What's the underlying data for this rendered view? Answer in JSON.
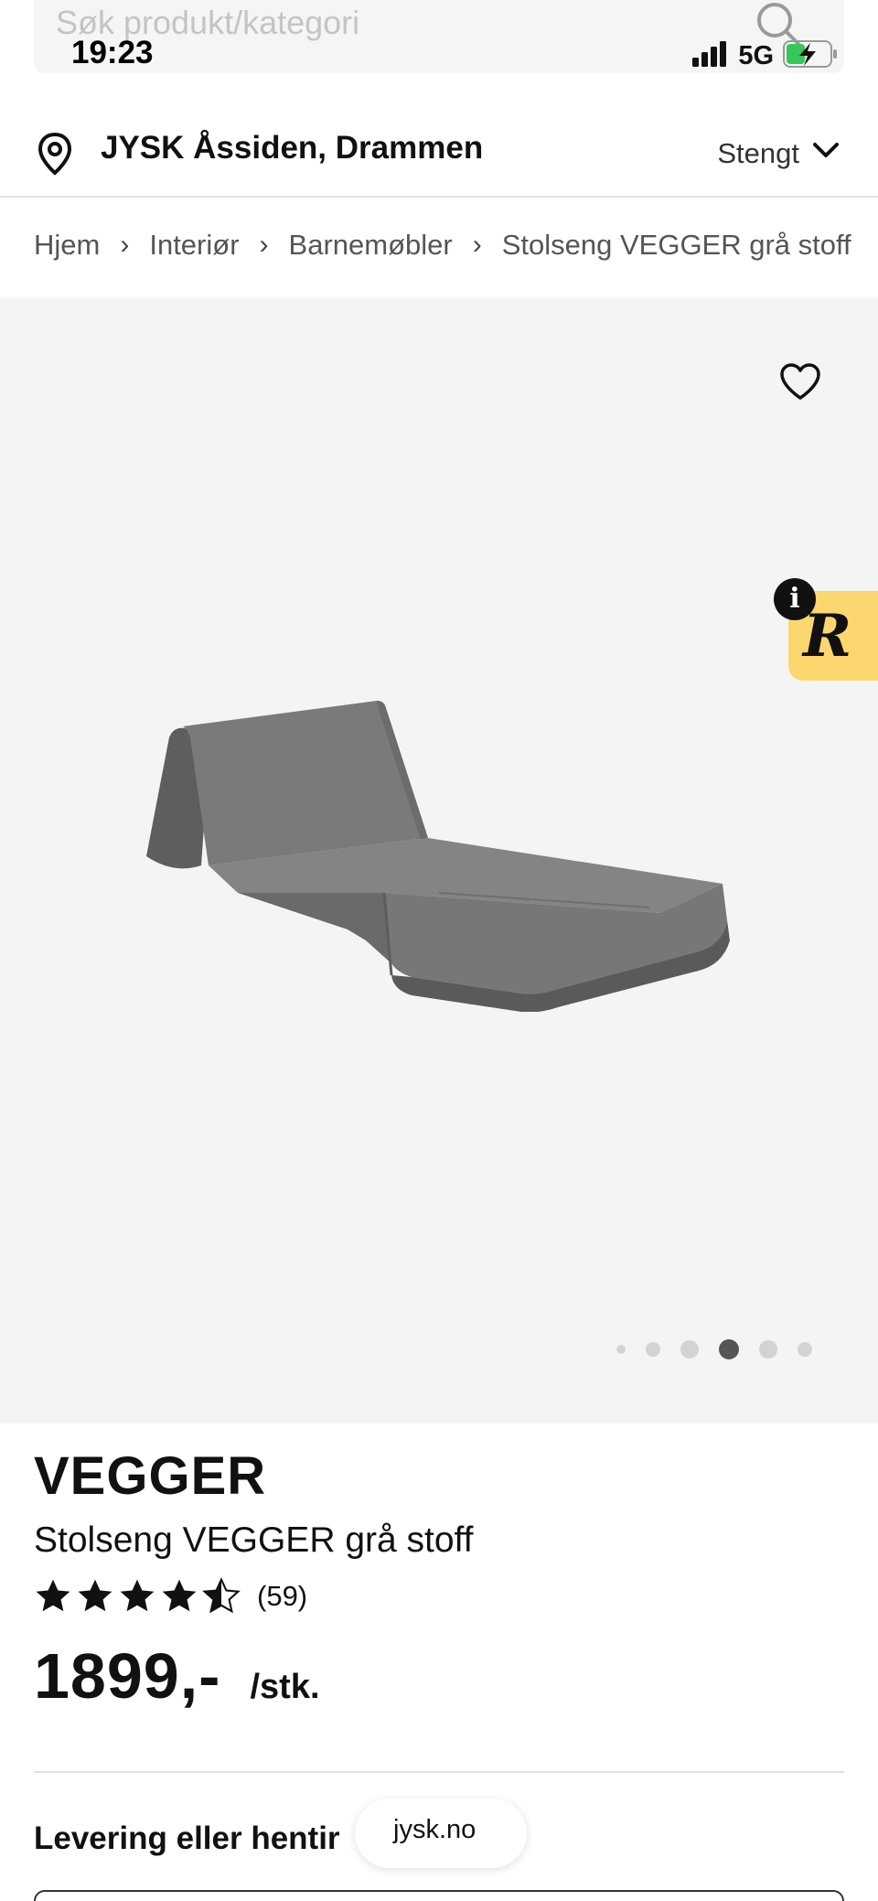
{
  "search": {
    "placeholder": "Søk produkt/kategori"
  },
  "status_bar": {
    "time": "19:23",
    "network": "5G",
    "battery_icon": "battery-charging-icon",
    "signal_icon": "signal-bars-icon"
  },
  "store": {
    "name": "JYSK Åssiden, Drammen",
    "status": "Stengt"
  },
  "breadcrumb": {
    "items": [
      "Hjem",
      "Interiør",
      "Barnemøbler",
      "Stolseng VEGGER grå stoff"
    ]
  },
  "gallery": {
    "total_images": 6,
    "active_index": 3,
    "badge_letter": "R",
    "info_letter": "i"
  },
  "product": {
    "brand": "VEGGER",
    "name": "Stolseng VEGGER grå stoff",
    "rating": 4.5,
    "review_count": "(59)",
    "price": "1899,-",
    "unit": "/stk."
  },
  "delivery": {
    "heading": "Levering eller hentir"
  },
  "browser": {
    "url": "jysk.no"
  },
  "colors": {
    "badge": "#fcd770",
    "text": "#111111",
    "gallery_bg": "#f4f4f4"
  }
}
